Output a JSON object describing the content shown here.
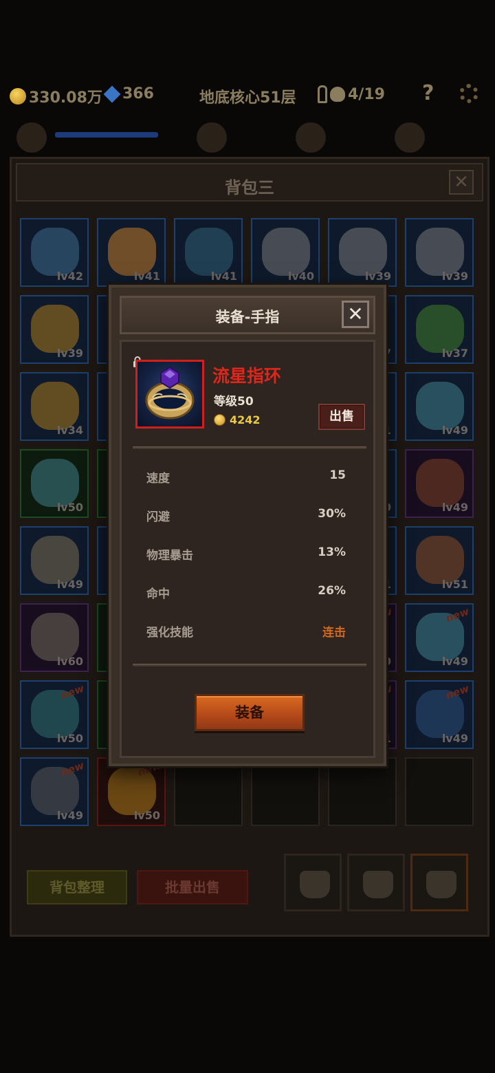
{
  "status_bar": {
    "gold": "330.08万",
    "gems": "366",
    "location": "地底核心51层",
    "keys": "",
    "kills": "4/19"
  },
  "bag": {
    "title": "背包三",
    "close_label": "✕",
    "sort_label": "背包整理",
    "bulk_sell_label": "批量出售",
    "slots": [
      {
        "lv": "lv42",
        "tier": "blue",
        "new": false,
        "art": "#3d6a8a"
      },
      {
        "lv": "lv41",
        "tier": "blue",
        "new": false,
        "art": "#c27a2a"
      },
      {
        "lv": "lv41",
        "tier": "blue",
        "new": false,
        "art": "#2f5e74"
      },
      {
        "lv": "lv40",
        "tier": "blue",
        "new": false,
        "art": "#777777"
      },
      {
        "lv": "lv39",
        "tier": "blue",
        "new": false,
        "art": "#777777"
      },
      {
        "lv": "lv39",
        "tier": "blue",
        "new": false,
        "art": "#777777"
      },
      {
        "lv": "lv39",
        "tier": "blue",
        "new": false,
        "art": "#a8791c"
      },
      {
        "lv": "",
        "tier": "blue",
        "new": false,
        "art": "#a8791c"
      },
      {
        "lv": "",
        "tier": "blue",
        "new": false,
        "art": "#000000"
      },
      {
        "lv": "",
        "tier": "blue",
        "new": false,
        "art": "#000000"
      },
      {
        "lv": "7",
        "tier": "blue",
        "new": false,
        "art": "#3b5a2a"
      },
      {
        "lv": "lv37",
        "tier": "blue",
        "new": false,
        "art": "#3f7a2a"
      },
      {
        "lv": "lv34",
        "tier": "blue",
        "new": false,
        "art": "#a8791c"
      },
      {
        "lv": "",
        "tier": "blue",
        "new": false,
        "art": "#a8791c"
      },
      {
        "lv": "",
        "tier": "blue",
        "new": false,
        "art": "#000000"
      },
      {
        "lv": "",
        "tier": "blue",
        "new": false,
        "art": "#000000"
      },
      {
        "lv": "1",
        "tier": "blue",
        "new": false,
        "art": "#3b5a2a"
      },
      {
        "lv": "lv49",
        "tier": "blue",
        "new": false,
        "art": "#3f7d88"
      },
      {
        "lv": "lv50",
        "tier": "green",
        "new": false,
        "art": "#3f7d88"
      },
      {
        "lv": "",
        "tier": "green",
        "new": false,
        "art": "#000000"
      },
      {
        "lv": "",
        "tier": "green",
        "new": false,
        "art": "#000000"
      },
      {
        "lv": "",
        "tier": "green",
        "new": false,
        "art": "#000000"
      },
      {
        "lv": "0",
        "tier": "blue",
        "new": false,
        "art": "#2c2c2c"
      },
      {
        "lv": "lv49",
        "tier": "purple",
        "new": false,
        "art": "#7a4020"
      },
      {
        "lv": "lv49",
        "tier": "blue",
        "new": false,
        "art": "#7a6a50"
      },
      {
        "lv": "",
        "tier": "blue",
        "new": false,
        "art": "#000000"
      },
      {
        "lv": "",
        "tier": "blue",
        "new": false,
        "art": "#000000"
      },
      {
        "lv": "",
        "tier": "blue",
        "new": false,
        "art": "#000000"
      },
      {
        "lv": "1",
        "tier": "blue",
        "new": false,
        "art": "#2c2c2c"
      },
      {
        "lv": "lv51",
        "tier": "blue",
        "new": false,
        "art": "#8a4a22"
      },
      {
        "lv": "lv60",
        "tier": "purple",
        "new": false,
        "art": "#6f6a55"
      },
      {
        "lv": "",
        "tier": "green",
        "new": false,
        "art": "#8a4a22"
      },
      {
        "lv": "",
        "tier": "blue",
        "new": false,
        "art": "#000000"
      },
      {
        "lv": "",
        "tier": "blue",
        "new": false,
        "art": "#000000"
      },
      {
        "lv": "0",
        "tier": "purple",
        "new": true,
        "art": "#2c2c2c"
      },
      {
        "lv": "lv49",
        "tier": "blue",
        "new": true,
        "art": "#3f7d88"
      },
      {
        "lv": "lv50",
        "tier": "blue",
        "new": true,
        "art": "#2f6e6a"
      },
      {
        "lv": "",
        "tier": "green",
        "new": false,
        "art": "#8a4a22"
      },
      {
        "lv": "",
        "tier": "blue",
        "new": false,
        "art": "#000000"
      },
      {
        "lv": "",
        "tier": "blue",
        "new": false,
        "art": "#000000"
      },
      {
        "lv": "1",
        "tier": "purple",
        "new": true,
        "art": "#2c2c2c"
      },
      {
        "lv": "lv49",
        "tier": "blue",
        "new": true,
        "art": "#2b4e7a"
      },
      {
        "lv": "lv49",
        "tier": "blue",
        "new": true,
        "art": "#555555"
      },
      {
        "lv": "lv50",
        "tier": "red",
        "new": true,
        "art": "#a8791c"
      },
      {
        "lv": "",
        "tier": "empty",
        "new": false,
        "art": ""
      },
      {
        "lv": "",
        "tier": "empty",
        "new": false,
        "art": ""
      },
      {
        "lv": "",
        "tier": "empty",
        "new": false,
        "art": ""
      },
      {
        "lv": "",
        "tier": "empty",
        "new": false,
        "art": ""
      }
    ]
  },
  "dialog": {
    "title": "装备-手指",
    "close_label": "✕",
    "item": {
      "name": "流星指环",
      "level": "等级50",
      "price": "4242",
      "locked": true
    },
    "sell_label": "出售",
    "stats": [
      {
        "label": "速度",
        "value": "15"
      },
      {
        "label": "闪避",
        "value": "30%"
      },
      {
        "label": "物理暴击",
        "value": "13%"
      },
      {
        "label": "命中",
        "value": "26%"
      },
      {
        "label": "强化技能",
        "value": "连击"
      }
    ],
    "equip_label": "装备"
  },
  "colors": {
    "item_name": "#e0261b",
    "gold_text": "#e9c94a",
    "skill_text": "#d2691e",
    "equip_button": "#c2571c"
  }
}
